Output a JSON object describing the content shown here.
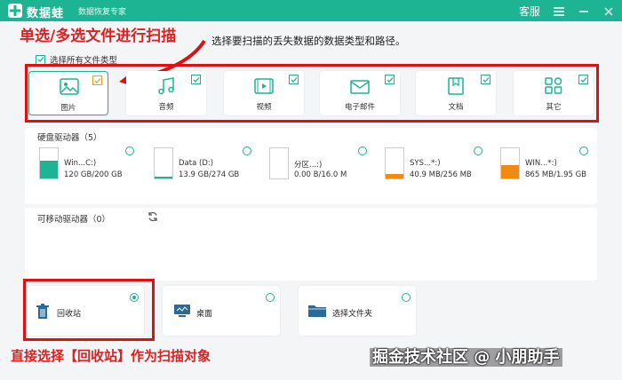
{
  "app": {
    "title": "数据蛙",
    "subtitle": "数据恢复专家",
    "service": "客服"
  },
  "colors": {
    "accent": "#1cb493",
    "annotation": "#e02020"
  },
  "annotations": {
    "top": "单选/多选文件进行扫描",
    "bottom": "直接选择【回收站】作为扫描对象"
  },
  "instruction": "选择要扫描的丢失数据的数据类型和路径。",
  "select_all": {
    "label": "选择所有文件类型",
    "checked": true
  },
  "file_types": [
    {
      "label": "图片",
      "icon": "image-icon",
      "checked": true
    },
    {
      "label": "音频",
      "icon": "music-icon",
      "checked": true
    },
    {
      "label": "视频",
      "icon": "video-icon",
      "checked": true
    },
    {
      "label": "电子邮件",
      "icon": "mail-icon",
      "checked": true
    },
    {
      "label": "文档",
      "icon": "document-icon",
      "checked": true
    },
    {
      "label": "其它",
      "icon": "other-icon",
      "checked": true
    }
  ],
  "hard_drives": {
    "title": "硬盘驱动器（5）",
    "items": [
      {
        "name": "Win...C:)",
        "size": "120 GB/200 GB",
        "used_fraction": 0.6
      },
      {
        "name": "Data (D:)",
        "size": "13.9 GB/274 GB",
        "used_fraction": 0.05
      },
      {
        "name": "分区...:)",
        "size": "0.00  B/16.0 M",
        "used_fraction": 0.0
      },
      {
        "name": "SYS...*:)",
        "size": "40.9 MB/256 MB",
        "used_fraction": 0.16
      },
      {
        "name": "WIN...*:)",
        "size": "865 MB/1.95 GB",
        "used_fraction": 0.44
      }
    ]
  },
  "removable": {
    "title": "可移动驱动器（0）"
  },
  "locations": [
    {
      "label": "回收站",
      "icon": "recycle-bin-icon",
      "selected": true
    },
    {
      "label": "桌面",
      "icon": "desktop-icon",
      "selected": false
    },
    {
      "label": "选择文件夹",
      "icon": "folder-icon",
      "selected": false
    }
  ],
  "watermark": "掘金技术社区 @ 小朋助手"
}
